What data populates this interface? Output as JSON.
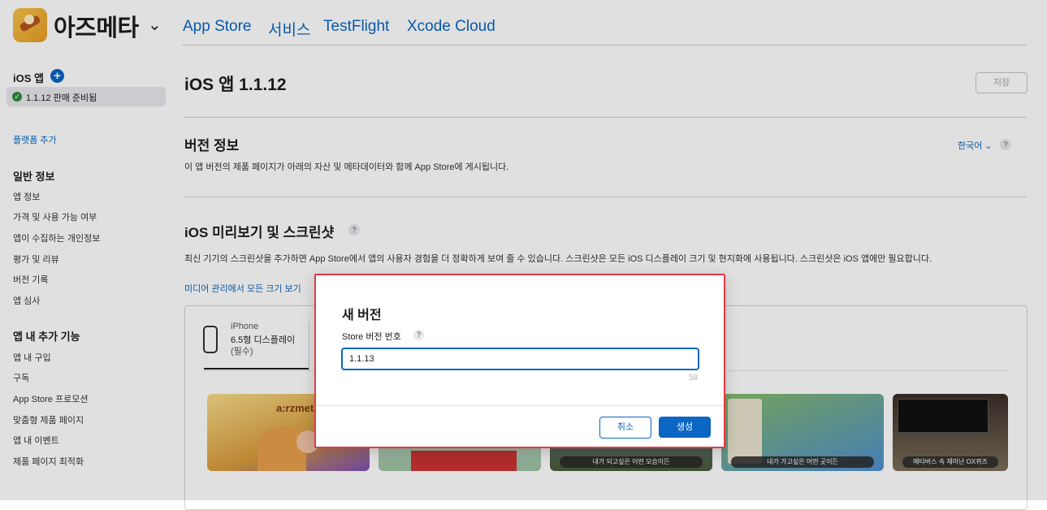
{
  "header": {
    "app_name": "아즈메타",
    "tabs": [
      "App Store",
      "서비스",
      "TestFlight",
      "Xcode Cloud"
    ]
  },
  "sidebar": {
    "ios_app_label": "iOS 앱",
    "version_item": "1.1.12 판매 준비됨",
    "add_platform": "플랫폼 추가",
    "general_heading": "일반 정보",
    "general_items": [
      "앱 정보",
      "가격 및 사용 가능 여부",
      "앱이 수집하는 개인정보",
      "평가 및 리뷰",
      "버전 기록",
      "앱 심사"
    ],
    "extras_heading": "앱 내 추가 기능",
    "extras_items": [
      "앱 내 구입",
      "구독",
      "App Store 프로모션",
      "맞춤형 제품 페이지",
      "앱 내 이벤트",
      "제품 페이지 최적화"
    ]
  },
  "main": {
    "title": "iOS 앱 1.1.12",
    "save_label": "저장",
    "version_info_title": "버전 정보",
    "version_info_desc": "이 앱 버전의 제품 페이지가 아래의 자산 및 메타데이터와 함께 App Store에 게시됩니다.",
    "language": "한국어 ⌄",
    "preview_title": "iOS 미리보기 및 스크린샷",
    "preview_desc": "최신 기기의 스크린샷을 추가하면 App Store에서 앱의 사용자 경험을 더 정확하게 보여 줄 수 있습니다. 스크린샷은 모든 iOS 디스플레이 크기 및 현지화에 사용됩니다. 스크린샷은 iOS 앱에만 필요합니다.",
    "media_link": "미디어 관리에서 모든 크기 보기",
    "device": {
      "line1": "iPhone",
      "line2": "6.5형 디스플레이",
      "line3": "(필수)"
    },
    "thumb_logo": "a:rzmeta",
    "thumb_captions": [
      "내가 되고싶은 어떤 모습이든",
      "내가 가고싶은 어떤 곳이든",
      "메타버스 속 재미난 OX퀴즈"
    ]
  },
  "dialog": {
    "title": "새 버전",
    "field_label": "Store 버전 번호",
    "field_value": "1.1.13",
    "char_count": "58",
    "cancel_label": "취소",
    "create_label": "생성"
  },
  "colors": {
    "accent": "#0a66c2",
    "highlight_border": "#e53945",
    "ready_green": "#2f8a3a"
  }
}
